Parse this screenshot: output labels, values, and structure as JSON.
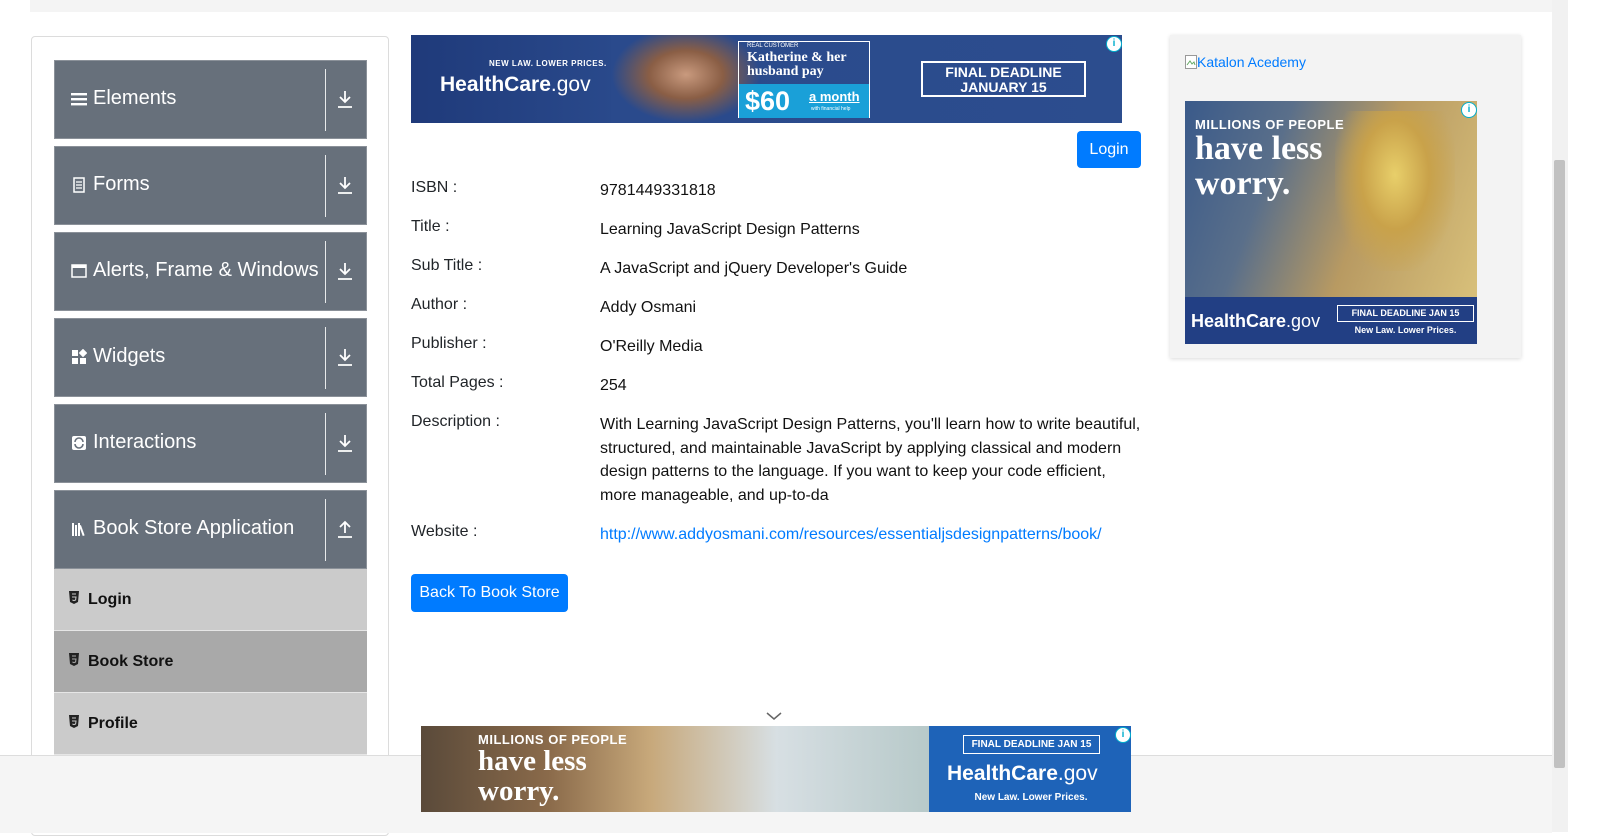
{
  "sidebar": {
    "groups": [
      {
        "label": "Elements",
        "icon": "menu-icon"
      },
      {
        "label": "Forms",
        "icon": "document-icon"
      },
      {
        "label": "Alerts, Frame & Windows",
        "icon": "window-icon"
      },
      {
        "label": "Widgets",
        "icon": "widgets-icon"
      },
      {
        "label": "Interactions",
        "icon": "interactions-icon"
      },
      {
        "label": "Book Store Application",
        "icon": "books-icon"
      }
    ],
    "items": [
      {
        "label": "Login"
      },
      {
        "label": "Book Store"
      },
      {
        "label": "Profile"
      }
    ]
  },
  "header": {
    "login_label": "Login"
  },
  "book": {
    "fields": [
      {
        "label": "ISBN :",
        "value": "9781449331818"
      },
      {
        "label": "Title :",
        "value": "Learning JavaScript Design Patterns"
      },
      {
        "label": "Sub Title :",
        "value": "A JavaScript and jQuery Developer's Guide"
      },
      {
        "label": "Author :",
        "value": "Addy Osmani"
      },
      {
        "label": "Publisher :",
        "value": "O'Reilly Media"
      },
      {
        "label": "Total Pages :",
        "value": "254"
      },
      {
        "label": "Description :",
        "value": "With Learning JavaScript Design Patterns, you'll learn how to write beautiful, structured, and maintainable JavaScript by applying classical and modern design patterns to the language. If you want to keep your code efficient, more manageable, and up-to-da"
      },
      {
        "label": "Website :",
        "value": "http://www.addyosmani.com/resources/essentialjsdesignpatterns/book/"
      }
    ],
    "back_label": "Back To Book Store"
  },
  "ads": {
    "top": {
      "tagline": "NEW LAW. LOWER PRICES.",
      "brand": "HealthCare",
      "brand_suffix": ".gov",
      "real_customer": "REAL CUSTOMER",
      "quote": "Katherine & her husband pay",
      "price": "$60",
      "per": "a month",
      "help": "with financial help",
      "deadline": "FINAL DEADLINE",
      "deadline_date": "JANUARY 15"
    },
    "right": {
      "link_text": "Katalon Acedemy",
      "headline_small": "MILLIONS OF PEOPLE",
      "headline_big1": "have less",
      "headline_big2": "worry.",
      "brand": "HealthCare",
      "brand_suffix": ".gov",
      "deadline": "FINAL DEADLINE JAN 15",
      "tagline": "New Law. Lower Prices."
    },
    "bottom": {
      "headline_small": "MILLIONS OF PEOPLE",
      "headline_big1": "have less",
      "headline_big2": "worry.",
      "deadline": "FINAL DEADLINE JAN 15",
      "brand": "HealthCare",
      "brand_suffix": ".gov",
      "tagline": "New Law. Lower Prices."
    },
    "info_glyph": "i"
  },
  "colors": {
    "primary": "#007bff",
    "group_bg": "#67707b",
    "sub_bg": "#cbcbcb",
    "sub_active_bg": "#a9a9a9",
    "ad_navy": "#233d7b"
  }
}
